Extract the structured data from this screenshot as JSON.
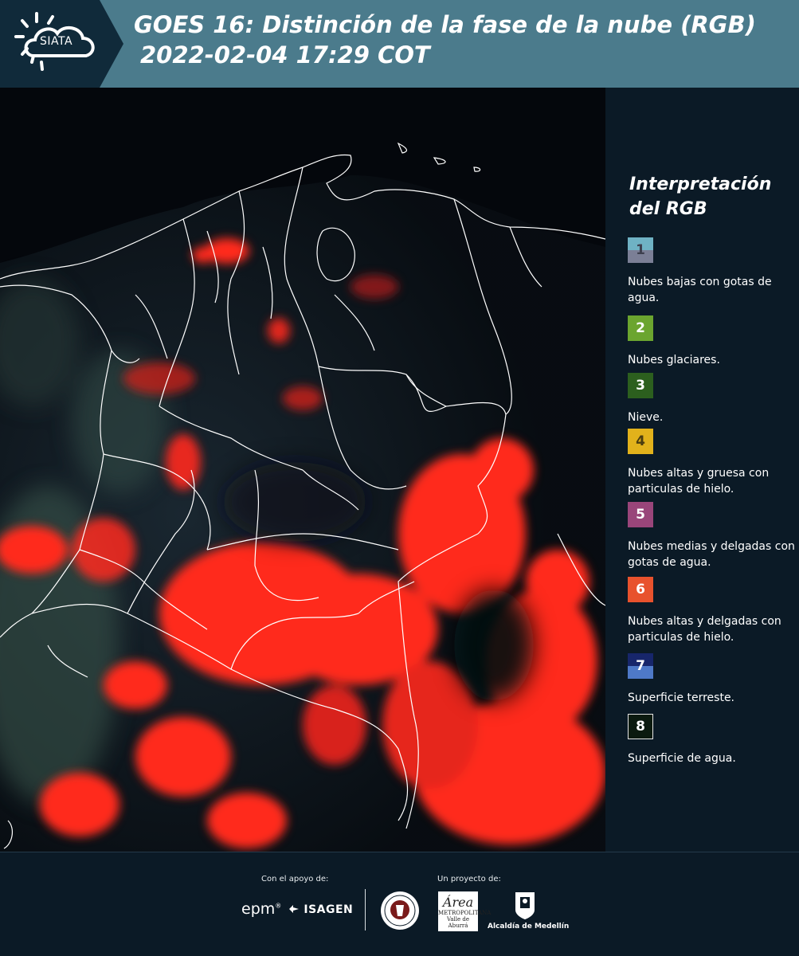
{
  "header": {
    "logo_text": "SIATA",
    "title_line1": "GOES 16: Distinción de la fase de la nube (RGB)",
    "title_line2": "2022-02-04 17:29 COT"
  },
  "map": {
    "product": "GOES 16 RGB",
    "colors": {
      "background": "#04070c",
      "ice_cloud": "#ff2a1c",
      "land": "#1a2630",
      "borders": "#ffffff"
    }
  },
  "legend": {
    "title": "Interpretación del RGB",
    "items": [
      {
        "num": "1",
        "label": "Nubes bajas con gotas de agua.",
        "color": "#6fb2c4"
      },
      {
        "num": "2",
        "label": "Nubes glaciares.",
        "color": "#6ba52f"
      },
      {
        "num": "3",
        "label": "Nieve.",
        "color": "#2c5f1e"
      },
      {
        "num": "4",
        "label": "Nubes altas y gruesa con particulas de hielo.",
        "color": "#e2b21b"
      },
      {
        "num": "5",
        "label": "Nubes medias y delgadas con gotas de agua.",
        "color": "#99457a"
      },
      {
        "num": "6",
        "label": "Nubes altas y delgadas con particulas de hielo.",
        "color": "#e8522d"
      },
      {
        "num": "7",
        "label": "Superficie terreste.",
        "color": "#4e79c8"
      },
      {
        "num": "8",
        "label": "Superficie de agua.",
        "color": "#0b1a0f"
      }
    ]
  },
  "footer": {
    "support_label": "Con el apoyo de:",
    "project_label": "Un proyecto de:",
    "epm": "epm",
    "isagen": "ISAGEN",
    "metro_big": "Área",
    "metro_line1": "METROPOLITANA",
    "metro_line2": "Valle de Aburrá",
    "medellin": "Alcaldía de Medellín"
  }
}
